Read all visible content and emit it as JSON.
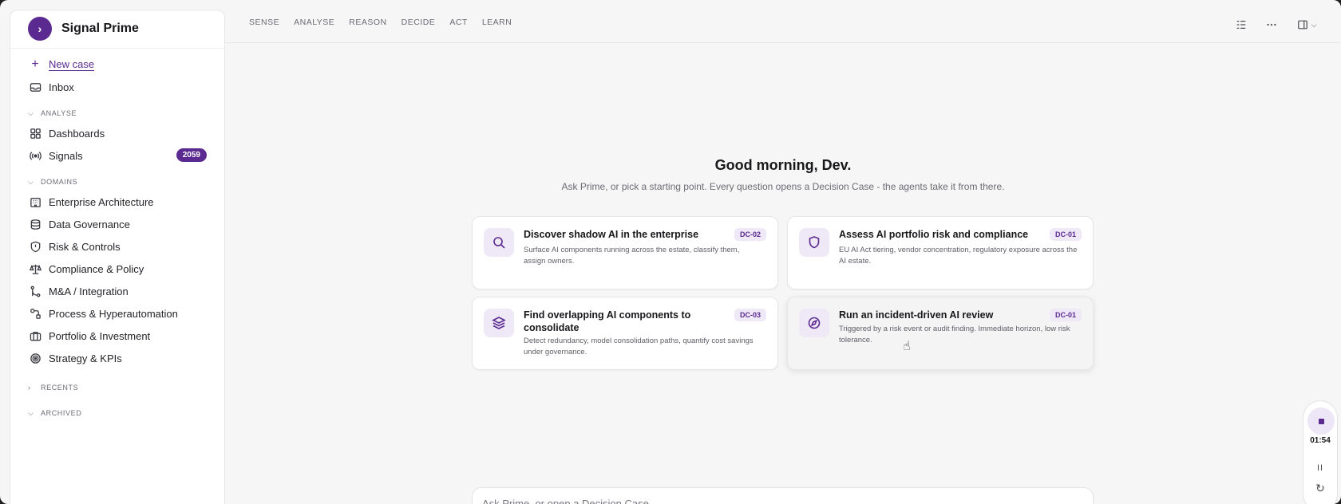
{
  "app": {
    "name": "Signal Prime",
    "brand_glyph": "›"
  },
  "sidebar": {
    "new_case": "New case",
    "inbox": "Inbox",
    "sections": {
      "analyse": "ANALYSE",
      "domains": "DOMAINS",
      "recents": "RECENTS",
      "archived": "ARCHIVED"
    },
    "analyse_items": [
      {
        "label": "Dashboards",
        "icon": "dashboard-icon"
      },
      {
        "label": "Signals",
        "icon": "signal-icon",
        "badge": "2059"
      }
    ],
    "domain_items": [
      {
        "label": "Enterprise Architecture",
        "icon": "building-icon"
      },
      {
        "label": "Data Governance",
        "icon": "database-icon"
      },
      {
        "label": "Risk & Controls",
        "icon": "shield-icon"
      },
      {
        "label": "Compliance & Policy",
        "icon": "scale-icon"
      },
      {
        "label": "M&A / Integration",
        "icon": "merge-icon"
      },
      {
        "label": "Process & Hyperautomation",
        "icon": "workflow-icon"
      },
      {
        "label": "Portfolio & Investment",
        "icon": "briefcase-icon"
      },
      {
        "label": "Strategy & KPIs",
        "icon": "target-icon"
      }
    ]
  },
  "topbar": {
    "tabs": [
      "SENSE",
      "ANALYSE",
      "REASON",
      "DECIDE",
      "ACT",
      "LEARN"
    ]
  },
  "main": {
    "greeting": "Good morning, Dev.",
    "subtitle": "Ask Prime, or pick a starting point. Every question opens a Decision Case - the agents take it from there.",
    "cards": [
      {
        "title": "Discover shadow AI in the enterprise",
        "desc": "Surface AI components running across the estate, classify them, assign owners.",
        "tag": "DC-02",
        "icon": "search-icon"
      },
      {
        "title": "Assess AI portfolio risk and compliance",
        "desc": "EU AI Act tiering, vendor concentration, regulatory exposure across the AI estate.",
        "tag": "DC-01",
        "icon": "shield-icon"
      },
      {
        "title": "Find overlapping AI components to consolidate",
        "desc": "Detect redundancy, model consolidation paths, quantify cost savings under governance.",
        "tag": "DC-03",
        "icon": "layers-icon"
      },
      {
        "title": "Run an incident-driven AI review",
        "desc": "Triggered by a risk event or audit finding. Immediate horizon, low risk tolerance.",
        "tag": "DC-01",
        "icon": "compass-icon"
      }
    ],
    "ask_placeholder": "Ask Prime, or open a Decision Case..."
  },
  "recorder": {
    "time": "01:54",
    "pause": "II",
    "refresh": "↻"
  },
  "colors": {
    "accent": "#5b2a91",
    "accent_soft": "#efe9f7",
    "background": "#f6f6f6"
  }
}
